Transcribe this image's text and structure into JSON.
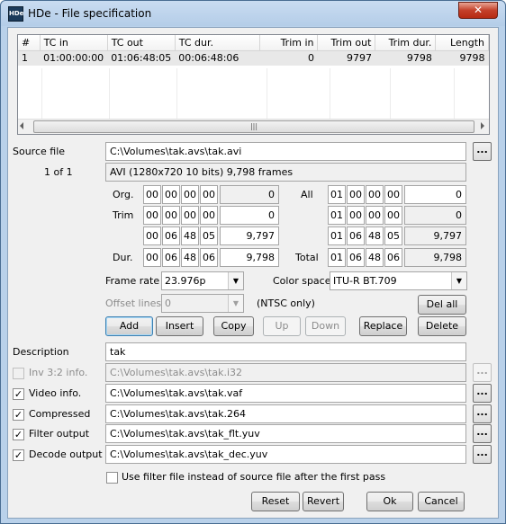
{
  "window": {
    "title": "HDe - File specification",
    "close_glyph": "✕",
    "icon_text": "HDe"
  },
  "list": {
    "columns": [
      "#",
      "TC in",
      "TC out",
      "TC dur.",
      "Trim in",
      "Trim out",
      "Trim dur.",
      "Length"
    ],
    "rows": [
      [
        "1",
        "01:00:00:00",
        "01:06:48:05",
        "00:06:48:06",
        "0",
        "9797",
        "9798",
        "9798"
      ]
    ]
  },
  "source": {
    "label": "Source file",
    "path": "C:\\Volumes\\tak.avs\\tak.avi",
    "counter": "1 of 1",
    "info": "AVI (1280x720 10 bits)  9,798 frames"
  },
  "timecodes": {
    "org_label": "Org.",
    "trim_label": "Trim",
    "dur_label": "Dur.",
    "all_label": "All",
    "total_label": "Total",
    "org": {
      "h": "00",
      "m": "00",
      "s": "00",
      "f": "00",
      "frames": "0"
    },
    "trim_in": {
      "h": "00",
      "m": "00",
      "s": "00",
      "f": "00",
      "frames": "0"
    },
    "trim_out": {
      "h": "00",
      "m": "06",
      "s": "48",
      "f": "05",
      "frames": "9,797"
    },
    "dur": {
      "h": "00",
      "m": "06",
      "s": "48",
      "f": "06",
      "frames": "9,798"
    },
    "all": {
      "h": "01",
      "m": "00",
      "s": "00",
      "f": "00",
      "frames": "0"
    },
    "all_trim_in": {
      "h": "01",
      "m": "00",
      "s": "00",
      "f": "00",
      "frames": "0"
    },
    "all_trim_out": {
      "h": "01",
      "m": "06",
      "s": "48",
      "f": "05",
      "frames": "9,797"
    },
    "total": {
      "h": "01",
      "m": "06",
      "s": "48",
      "f": "06",
      "frames": "9,798"
    }
  },
  "options": {
    "frame_rate_label": "Frame rate",
    "frame_rate": "23.976p",
    "color_space_label": "Color space",
    "color_space": "ITU-R BT.709",
    "offset_lines_label": "Offset lines",
    "offset_lines": "0",
    "ntsc_note": "(NTSC only)"
  },
  "buttons": {
    "del_all": "Del all",
    "add": "Add",
    "insert": "Insert",
    "copy": "Copy",
    "up": "Up",
    "down": "Down",
    "replace": "Replace",
    "delete": "Delete",
    "reset": "Reset",
    "revert": "Revert",
    "ok": "Ok",
    "cancel": "Cancel",
    "browse": "..."
  },
  "description": {
    "label": "Description",
    "value": "tak"
  },
  "files": [
    {
      "label": "Inv 3:2  info.",
      "checked": false,
      "enabled": false,
      "path": "C:\\Volumes\\tak.avs\\tak.i32"
    },
    {
      "label": "Video info.",
      "checked": true,
      "enabled": true,
      "path": "C:\\Volumes\\tak.avs\\tak.vaf"
    },
    {
      "label": "Compressed",
      "checked": true,
      "enabled": true,
      "path": "C:\\Volumes\\tak.avs\\tak.264"
    },
    {
      "label": "Filter output",
      "checked": true,
      "enabled": true,
      "path": "C:\\Volumes\\tak.avs\\tak_flt.yuv"
    },
    {
      "label": "Decode output",
      "checked": true,
      "enabled": true,
      "path": "C:\\Volumes\\tak.avs\\tak_dec.yuv"
    }
  ],
  "filter_checkbox": {
    "label": "Use filter file instead of source file after the first pass",
    "checked": false
  },
  "checkmark": "✓"
}
